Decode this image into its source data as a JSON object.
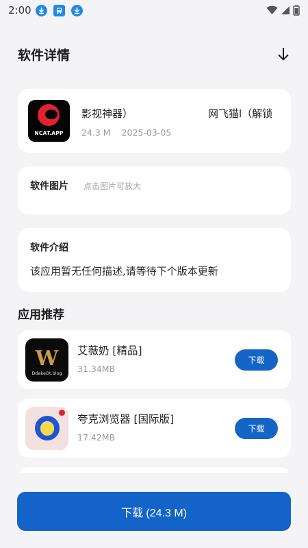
{
  "status_bar": {
    "time": "2:00",
    "icons": [
      "download-notification-icon",
      "bus-notification-icon",
      "download-notification-icon",
      "wifi-icon",
      "signal-icon",
      "battery-icon"
    ]
  },
  "header": {
    "title": "软件详情",
    "action_icon": "download-arrow-icon"
  },
  "app": {
    "icon_text": "NCAT.APP",
    "name_left": "影视神器）",
    "name_right": "网飞猫l（解锁",
    "size": "24.3 M",
    "date": "2025-03-05"
  },
  "images": {
    "label": "软件图片",
    "hint": "点击图片可放大"
  },
  "intro": {
    "title": "软件介绍",
    "text": "该应用暂无任何描述,请等待下个版本更新"
  },
  "recommend": {
    "title": "应用推荐",
    "items": [
      {
        "name": "艾薇奶 [精品]",
        "size": "31.34MB",
        "button": "下载",
        "icon_logo": "W",
        "icon_text": "DdakeDt.blog"
      },
      {
        "name": "夸克浏览器 [国际版]",
        "size": "17.42MB",
        "button": "下载"
      }
    ]
  },
  "download_button": "下载 (24.3 M)",
  "colors": {
    "accent": "#1463c8",
    "background": "#f4f4f6",
    "card": "#ffffff",
    "muted_text": "#9a9a9a"
  }
}
